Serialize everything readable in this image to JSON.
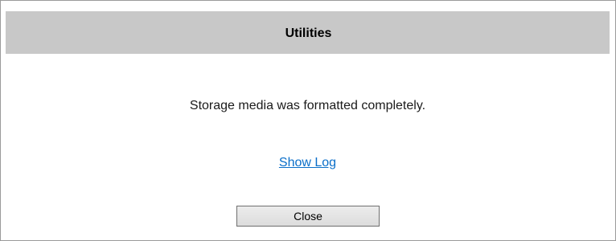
{
  "dialog": {
    "title": "Utilities",
    "message": "Storage media was formatted completely.",
    "link_label": "Show Log",
    "close_label": "Close"
  },
  "colors": {
    "header_bg": "#c8c8c8",
    "link": "#0b6fc9",
    "border": "#9a9a9a"
  }
}
